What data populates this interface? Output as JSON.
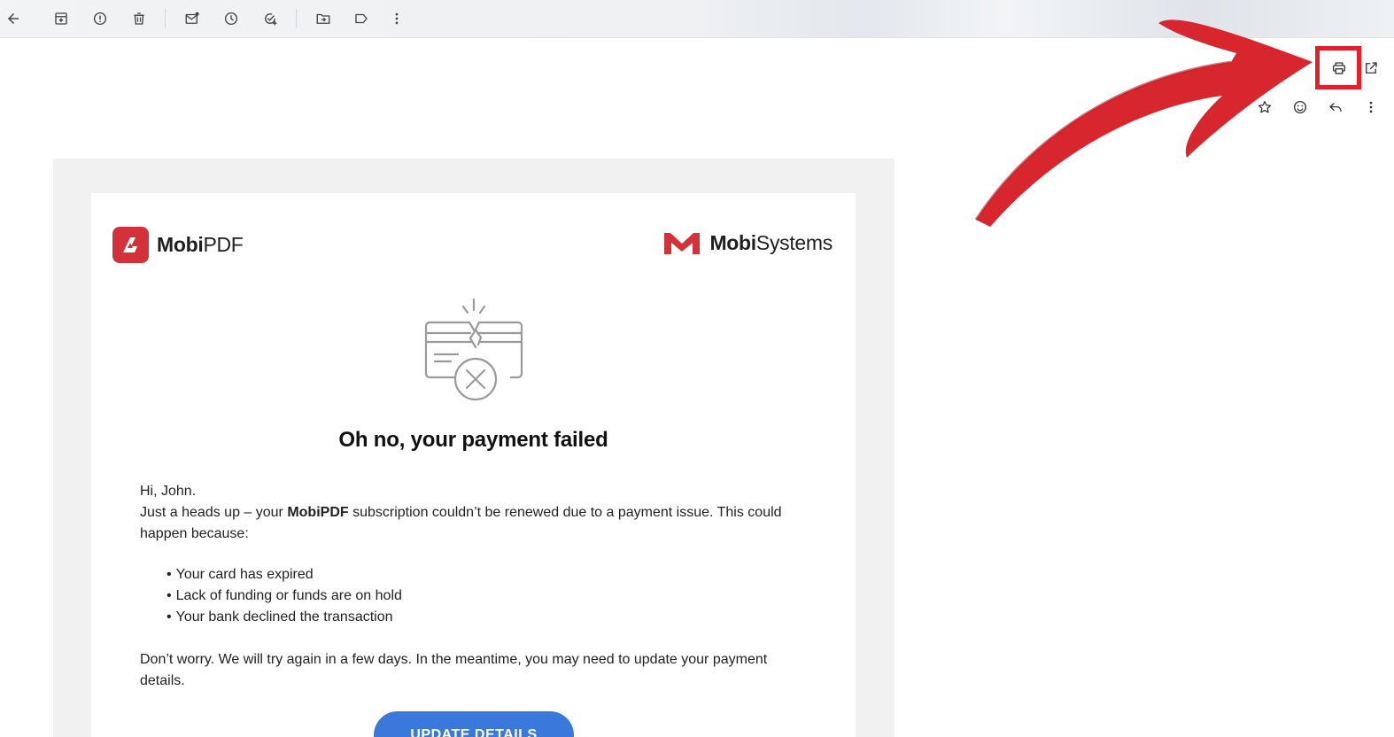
{
  "toolbar": {
    "icons": [
      "back-arrow-icon",
      "archive-icon",
      "report-spam-icon",
      "delete-icon",
      "mark-unread-icon",
      "snooze-icon",
      "add-task-icon",
      "move-to-icon",
      "label-icon",
      "more-vert-icon"
    ]
  },
  "actions": {
    "icons": [
      "print-icon",
      "open-new-window-icon",
      "star-icon",
      "emoji-icon",
      "reply-icon",
      "more-vert-icon"
    ]
  },
  "email": {
    "brand_left": {
      "bold": "Mobi",
      "regular": "PDF"
    },
    "brand_right": {
      "bold": "Mobi",
      "regular": "Systems"
    },
    "headline": "Oh no, your payment failed",
    "greeting": "Hi, John.",
    "intro_before": "Just a heads up – your ",
    "intro_bold": "MobiPDF",
    "intro_after": " subscription couldn’t be renewed due to a payment issue. This could happen because:",
    "reasons": [
      "Your card has expired",
      "Lack of funding or funds are on hold",
      "Your bank declined the transaction"
    ],
    "closing": "Don’t worry. We will try again in a few days. In the meantime, you may need to update your payment details.",
    "cta_label": "UPDATE DETAILS"
  },
  "colors": {
    "annotation_red": "#e0202f",
    "brand_red": "#d3323a",
    "cta_blue": "#3b78dc"
  }
}
